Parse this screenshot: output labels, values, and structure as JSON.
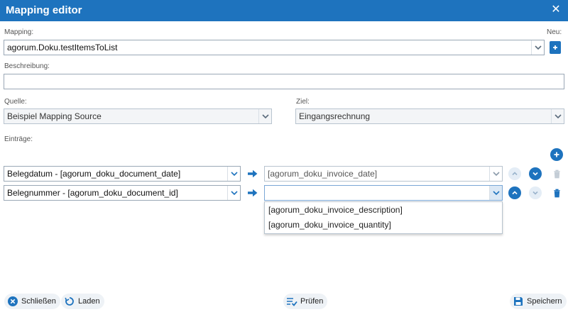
{
  "window": {
    "title": "Mapping editor"
  },
  "mapping": {
    "label": "Mapping:",
    "value": "agorum.Doku.testItemsToList",
    "new_label": "Neu:"
  },
  "beschreibung": {
    "label": "Beschreibung:",
    "value": ""
  },
  "quelle": {
    "label": "Quelle:",
    "value": "Beispiel Mapping Source"
  },
  "ziel": {
    "label": "Ziel:",
    "value": "Eingangsrechnung"
  },
  "eintraege": {
    "label": "Einträge:",
    "rows": [
      {
        "source": "Belegdatum - [agorum_doku_document_date]",
        "target": "[agorum_doku_invoice_date]"
      },
      {
        "source": "Belegnummer - [agorum_doku_document_id]",
        "target": ""
      }
    ]
  },
  "dropdown": {
    "options": [
      "[agorum_doku_invoice_description]",
      "[agorum_doku_invoice_quantity]"
    ]
  },
  "footer": {
    "close_label": "Schließen",
    "load_label": "Laden",
    "check_label": "Prüfen",
    "save_label": "Speichern"
  },
  "colors": {
    "accent": "#1e73be",
    "button_bg": "#eef2f6",
    "border": "#b8c4cf"
  }
}
